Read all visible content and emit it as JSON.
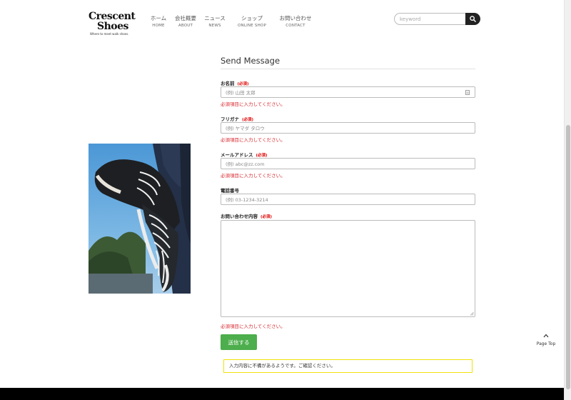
{
  "brand": {
    "line1": "Crescent",
    "line2": "Shoes",
    "tagline": "Where to meet walk shoes."
  },
  "nav": {
    "items": [
      {
        "jp": "ホーム",
        "en": "HOME"
      },
      {
        "jp": "会社概要",
        "en": "ABOUT"
      },
      {
        "jp": "ニュース",
        "en": "NEWS"
      },
      {
        "jp": "ショップ",
        "en": "ONLINE SHOP"
      },
      {
        "jp": "お問い合わせ",
        "en": "CONTACT"
      }
    ]
  },
  "search": {
    "placeholder": "keyword",
    "icon": "search-icon"
  },
  "form": {
    "title": "Send Message",
    "required_tag": "(必須)",
    "error_text": "必須項目に入力してください。",
    "name_label": "お名前",
    "name_placeholder": "(例) 山田 太郎",
    "kana_label": "フリガナ",
    "kana_placeholder": "(例) ヤマダ タロウ",
    "email_label": "メールアドレス",
    "email_placeholder": "(例) abc@zz.com",
    "phone_label": "電話番号",
    "phone_placeholder": "(例) 03-1234-3214",
    "message_label": "お問い合わせ内容",
    "submit_label": "送信する",
    "notice": "入力内容に不備があるようです。ご確認ください。"
  },
  "page_top": {
    "label": "Page Top"
  },
  "colors": {
    "error": "#d9232a",
    "required": "#dd0000",
    "submit": "#4cae4c",
    "notice_border": "#f1e20b",
    "footer": "#000000"
  }
}
